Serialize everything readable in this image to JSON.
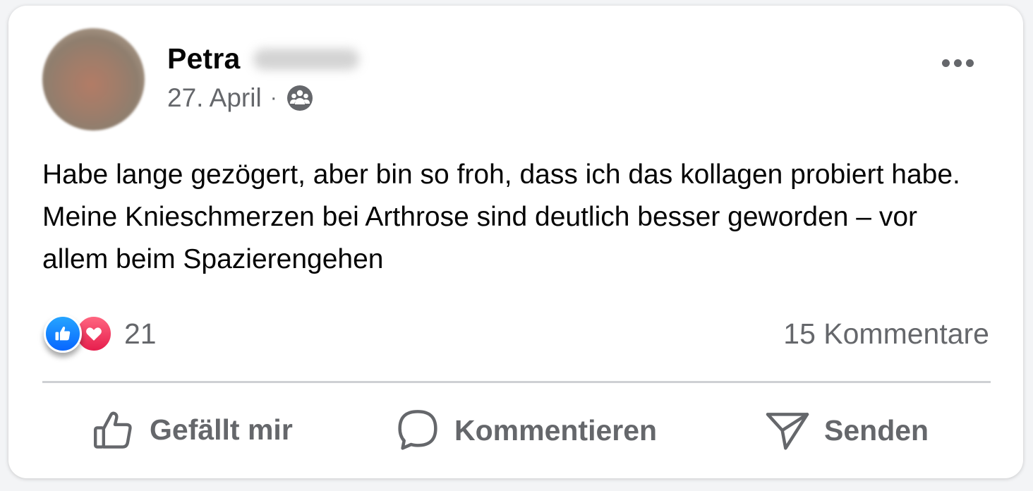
{
  "post": {
    "author_first_name": "Petra",
    "date": "27. April",
    "separator": "·",
    "audience_icon": "group-icon",
    "more_icon": "more-horizontal-icon",
    "text": "Habe lange gezögert, aber bin so froh, dass ich das kollagen probiert habe. Meine Knieschmerzen bei Arthrose sind deutlich besser geworden – vor allem beim Spazierengehen"
  },
  "engagement": {
    "reactions": [
      "like",
      "love"
    ],
    "reaction_count": "21",
    "comment_count_label": "15 Kommentare"
  },
  "actions": {
    "like_label": "Gefällt mir",
    "comment_label": "Kommentieren",
    "send_label": "Senden"
  },
  "colors": {
    "like_blue": "#0866ff",
    "love_red": "#f33e58",
    "secondary_text": "#65676b",
    "primary_text": "#050505"
  }
}
